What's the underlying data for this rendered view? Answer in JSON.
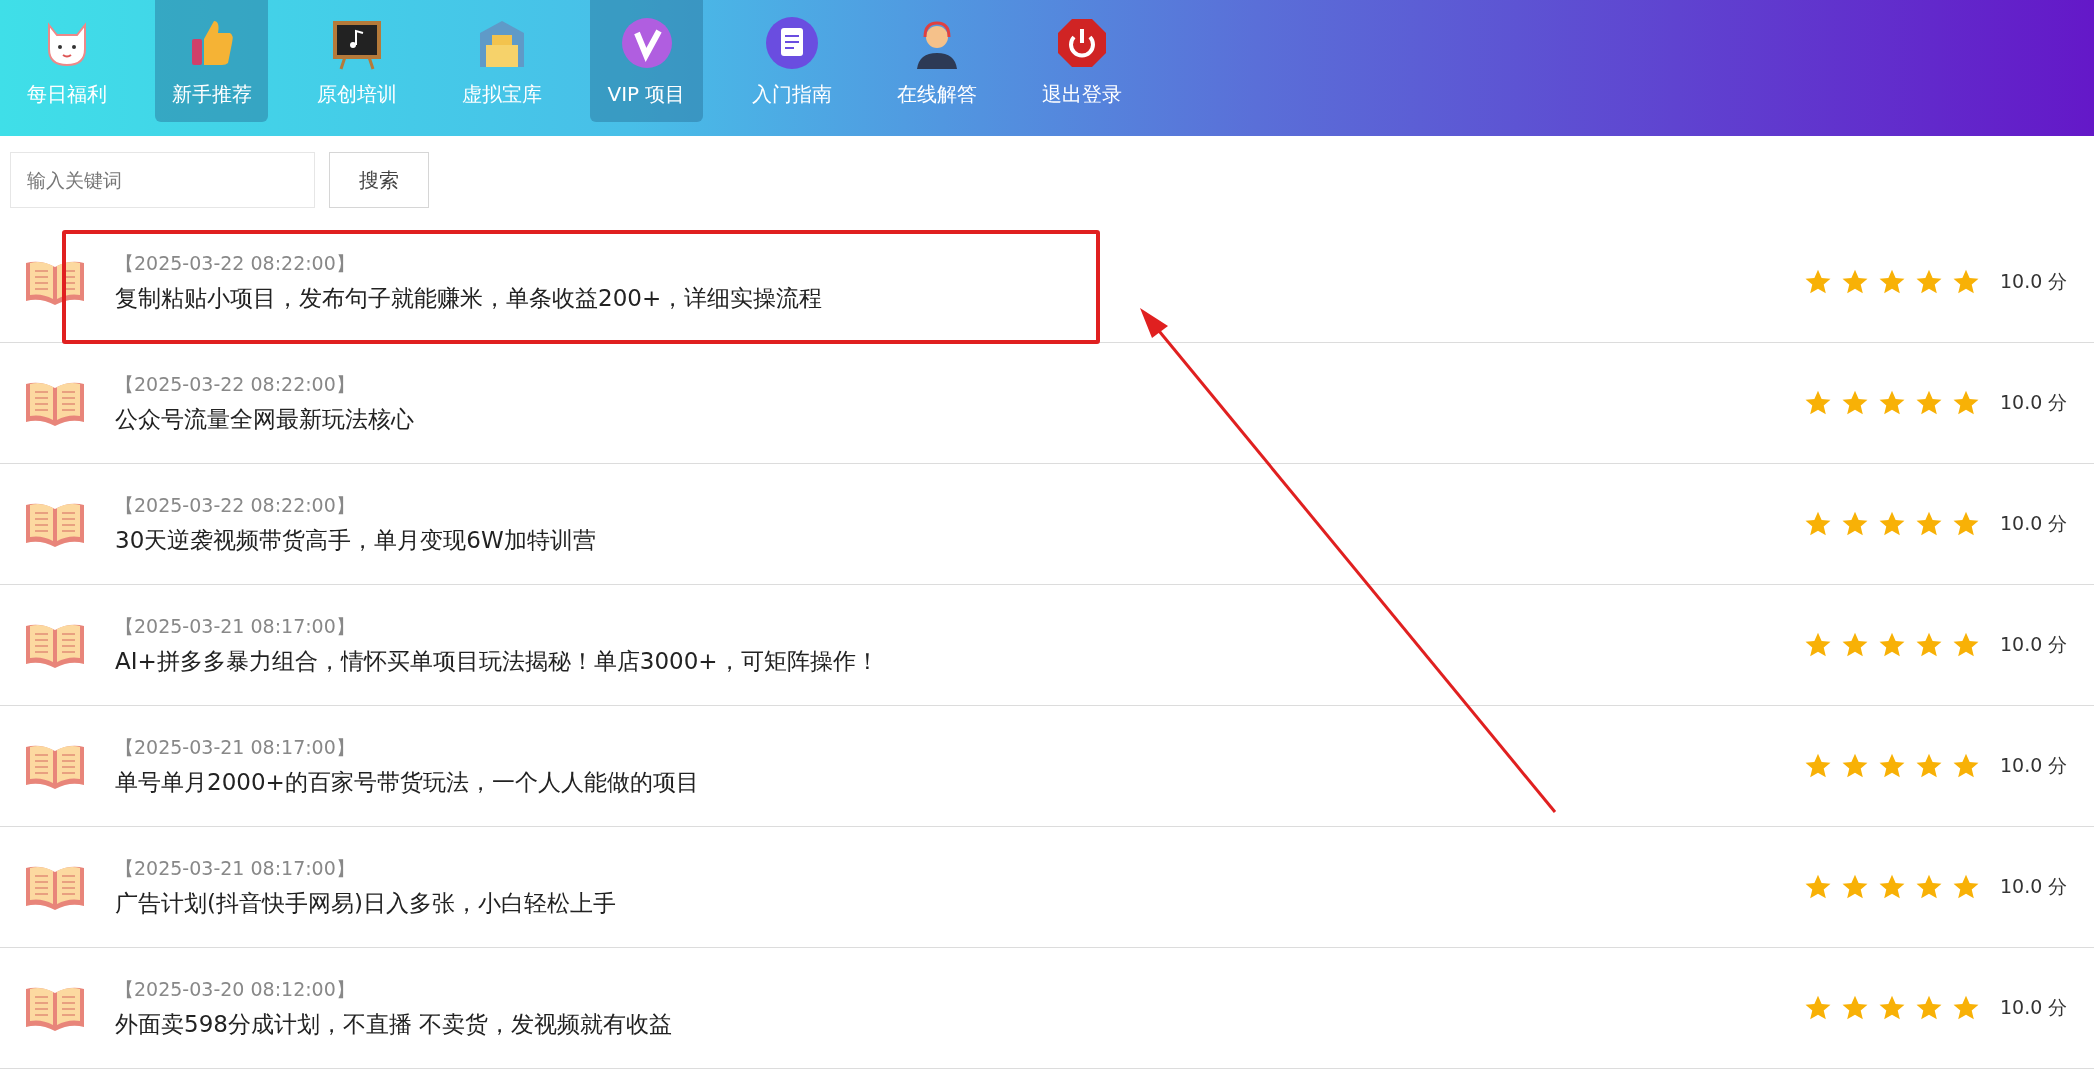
{
  "nav": [
    {
      "label": "每日福利",
      "highlighted": false
    },
    {
      "label": "新手推荐",
      "highlighted": true
    },
    {
      "label": "原创培训",
      "highlighted": false
    },
    {
      "label": "虚拟宝库",
      "highlighted": false
    },
    {
      "label": "VIP 项目",
      "highlighted": true
    },
    {
      "label": "入门指南",
      "highlighted": false
    },
    {
      "label": "在线解答",
      "highlighted": false
    },
    {
      "label": "退出登录",
      "highlighted": false
    }
  ],
  "search": {
    "placeholder": "输入关键词",
    "button": "搜索"
  },
  "rows": [
    {
      "date": "【2025-03-22 08:22:00】",
      "title": "复制粘贴小项目，发布句子就能赚米，单条收益200+，详细实操流程",
      "stars": 5,
      "score": "10.0 分",
      "annotated": true
    },
    {
      "date": "【2025-03-22 08:22:00】",
      "title": "公众号流量全网最新玩法核心",
      "stars": 5,
      "score": "10.0 分",
      "annotated": false
    },
    {
      "date": "【2025-03-22 08:22:00】",
      "title": "30天逆袭视频带货高手，单月变现6W加特训营",
      "stars": 5,
      "score": "10.0 分",
      "annotated": false
    },
    {
      "date": "【2025-03-21 08:17:00】",
      "title": "AI+拼多多暴力组合，情怀买单项目玩法揭秘！单店3000+，可矩阵操作！",
      "stars": 5,
      "score": "10.0 分",
      "annotated": false
    },
    {
      "date": "【2025-03-21 08:17:00】",
      "title": "单号单月2000+的百家号带货玩法，一个人人能做的项目",
      "stars": 5,
      "score": "10.0 分",
      "annotated": false
    },
    {
      "date": "【2025-03-21 08:17:00】",
      "title": "广告计划(抖音快手网易)日入多张，小白轻松上手",
      "stars": 5,
      "score": "10.0 分",
      "annotated": false
    },
    {
      "date": "【2025-03-20 08:12:00】",
      "title": "外面卖598分成计划，不直播 不卖货，发视频就有收益",
      "stars": 5,
      "score": "10.0 分",
      "annotated": false
    }
  ]
}
